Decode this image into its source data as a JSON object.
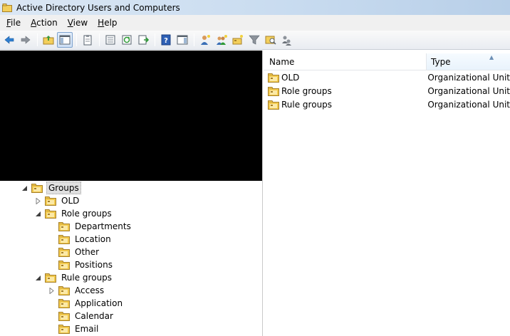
{
  "window": {
    "title": "Active Directory Users and Computers"
  },
  "menu": [
    {
      "first": "F",
      "rest": "ile"
    },
    {
      "first": "A",
      "rest": "ction"
    },
    {
      "first": "V",
      "rest": "iew"
    },
    {
      "first": "H",
      "rest": "elp"
    }
  ],
  "toolbar": {
    "buttons": [
      "back-arrow-icon",
      "forward-arrow-icon",
      "up-folder-icon",
      "show-console-tree-icon",
      "clipboard-icon",
      "properties-icon",
      "refresh-icon",
      "export-list-icon",
      "help-icon",
      "action-pane-icon",
      "create-user-icon",
      "create-group-icon",
      "create-ou-icon",
      "filter-icon",
      "find-icon",
      "add-to-group-icon"
    ]
  },
  "tree": {
    "nodes": [
      {
        "label": "Groups",
        "level": 0,
        "state": "expanded",
        "selected": true
      },
      {
        "label": "OLD",
        "level": 1,
        "state": "collapsed"
      },
      {
        "label": "Role groups",
        "level": 1,
        "state": "expanded"
      },
      {
        "label": "Departments",
        "level": 2,
        "state": "leaf"
      },
      {
        "label": "Location",
        "level": 2,
        "state": "leaf"
      },
      {
        "label": "Other",
        "level": 2,
        "state": "leaf"
      },
      {
        "label": "Positions",
        "level": 2,
        "state": "leaf"
      },
      {
        "label": "Rule groups",
        "level": 1,
        "state": "expanded"
      },
      {
        "label": "Access",
        "level": 2,
        "state": "collapsed"
      },
      {
        "label": "Application",
        "level": 2,
        "state": "leaf"
      },
      {
        "label": "Calendar",
        "level": 2,
        "state": "leaf"
      },
      {
        "label": "Email",
        "level": 2,
        "state": "leaf"
      }
    ]
  },
  "list": {
    "columns": {
      "name": "Name",
      "type": "Type"
    },
    "rows": [
      {
        "name": "OLD",
        "type": "Organizational Unit"
      },
      {
        "name": "Role groups",
        "type": "Organizational Unit"
      },
      {
        "name": "Rule groups",
        "type": "Organizational Unit"
      }
    ]
  },
  "colors": {
    "folder_yellow": "#f2c94c",
    "selection_gray": "#e0e0e0",
    "redacted_block": "#000000"
  }
}
